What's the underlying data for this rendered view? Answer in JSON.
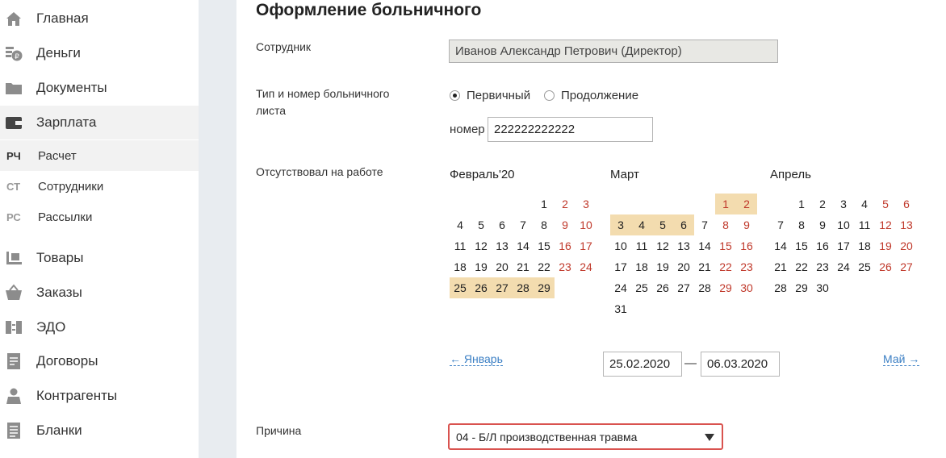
{
  "sidebar": {
    "items": [
      {
        "label": "Главная",
        "icon": "home-icon"
      },
      {
        "label": "Деньги",
        "icon": "money-icon"
      },
      {
        "label": "Документы",
        "icon": "folder-icon"
      },
      {
        "label": "Зарплата",
        "icon": "wallet-icon"
      },
      {
        "label": "Товары",
        "icon": "goods-icon"
      },
      {
        "label": "Заказы",
        "icon": "basket-icon"
      },
      {
        "label": "ЭДО",
        "icon": "edo-icon"
      },
      {
        "label": "Договоры",
        "icon": "contract-icon"
      },
      {
        "label": "Контрагенты",
        "icon": "contractors-icon"
      },
      {
        "label": "Бланки",
        "icon": "forms-icon"
      }
    ],
    "subitems": [
      {
        "code": "РЧ",
        "label": "Расчет"
      },
      {
        "code": "СТ",
        "label": "Сотрудники"
      },
      {
        "code": "РС",
        "label": "Рассылки"
      }
    ],
    "active_item": "Зарплата",
    "active_subitem": "Расчет"
  },
  "form": {
    "title": "Оформление больничного",
    "employee_label": "Сотрудник",
    "employee_value": "Иванов Александр Петрович (Директор)",
    "type_label": "Тип и номер больничного листа",
    "type_options": [
      "Первичный",
      "Продолжение"
    ],
    "type_selected": "Первичный",
    "number_label": "номер",
    "number_value": "222222222222",
    "absence_label": "Отсутствовал на работе",
    "prev_link": "← Январь",
    "next_link": "Май →",
    "date_from": "25.02.2020",
    "date_separator": "—",
    "date_to": "06.03.2020",
    "reason_label": "Причина",
    "reason_value": "04 - Б/Л производственная травма"
  },
  "calendars": [
    {
      "title": "Февраль'20",
      "first_weekday": 5,
      "days": 29,
      "selected": [
        25,
        26,
        27,
        28,
        29
      ]
    },
    {
      "title": "Март",
      "first_weekday": 6,
      "days": 31,
      "selected": [
        1,
        2,
        3,
        4,
        5,
        6
      ]
    },
    {
      "title": "Апрель",
      "first_weekday": 2,
      "days": 30,
      "selected": []
    }
  ],
  "colors": {
    "selected_day": "#f3dcaf",
    "weekend": "#c0392b",
    "link": "#3b7fc4",
    "reason_border": "#d9534f"
  }
}
